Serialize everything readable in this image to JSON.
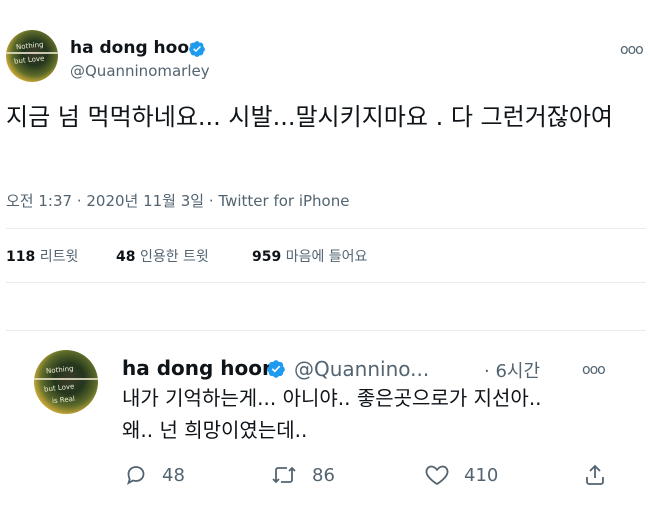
{
  "tweet": {
    "display_name": "ha dong hoon",
    "handle": "@Quanninomarley",
    "text": "지금 넘 먹먹하네요... 시발...말시키지마요 . 다 그런거잖아여",
    "timestamp": "오전 1:37 · 2020년 11월 3일 · Twitter for iPhone",
    "more_icon": "more-dots-icon",
    "verified_color": "#1d9bf0"
  },
  "stats": {
    "retweets_count": "118",
    "retweets_label": "리트윗",
    "quotes_count": "48",
    "quotes_label": "인용한 트윗",
    "likes_count": "959",
    "likes_label": "마음에 들어요"
  },
  "reply": {
    "display_name": "ha dong hoon",
    "handle": "@Quannino...",
    "time": "· 6시간",
    "line1": "내가 기억하는게... 아니야.. 좋은곳으로가 지선아..",
    "line2": "왜.. 넌 희망이였는데..",
    "actions": {
      "reply_count": "48",
      "retweet_count": "86",
      "like_count": "410"
    }
  }
}
